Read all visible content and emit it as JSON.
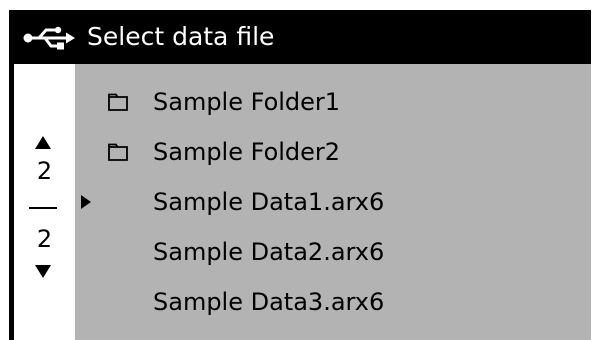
{
  "title": "Select data file",
  "title_icon": "usb-icon",
  "pager": {
    "current_page": "2",
    "total_pages": "2",
    "up_icon": "triangle-up-icon",
    "down_icon": "triangle-down-icon"
  },
  "cursor_icon": "triangle-right-icon",
  "selected_index": 2,
  "items": [
    {
      "label": "Sample Folder1",
      "type": "folder",
      "icon": "folder-icon"
    },
    {
      "label": "Sample Folder2",
      "type": "folder",
      "icon": "folder-icon"
    },
    {
      "label": "Sample Data1.arx6",
      "type": "file",
      "icon": ""
    },
    {
      "label": "Sample Data2.arx6",
      "type": "file",
      "icon": ""
    },
    {
      "label": "Sample Data3.arx6",
      "type": "file",
      "icon": ""
    }
  ],
  "colors": {
    "titlebar_bg": "#000000",
    "titlebar_fg": "#ffffff",
    "list_bg": "#b3b3b3",
    "pager_bg": "#ffffff",
    "text": "#000000"
  }
}
